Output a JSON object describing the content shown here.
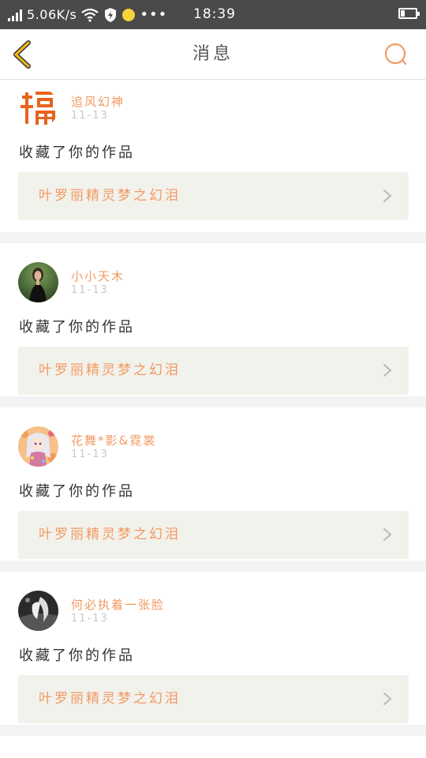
{
  "status_bar": {
    "speed": "5.06K/s",
    "time": "18:39"
  },
  "header": {
    "title": "消息"
  },
  "colors": {
    "accent": "#f29a63",
    "back_arrow": "#f3b51c",
    "status_bg": "#4a4a4a",
    "work_box_bg": "#f2f2ec"
  },
  "messages": [
    {
      "user": "追风幻神",
      "date": "11-13",
      "action": "收藏了你的作品",
      "work_title": "叶罗丽精灵梦之幻泪"
    },
    {
      "user": "小小天木",
      "date": "11-13",
      "action": "收藏了你的作品",
      "work_title": "叶罗丽精灵梦之幻泪"
    },
    {
      "user": "花舞*影&霓裳",
      "date": "11-13",
      "action": "收藏了你的作品",
      "work_title": "叶罗丽精灵梦之幻泪"
    },
    {
      "user": "何必执着一张脸",
      "date": "11-13",
      "action": "收藏了你的作品",
      "work_title": "叶罗丽精灵梦之幻泪"
    }
  ]
}
